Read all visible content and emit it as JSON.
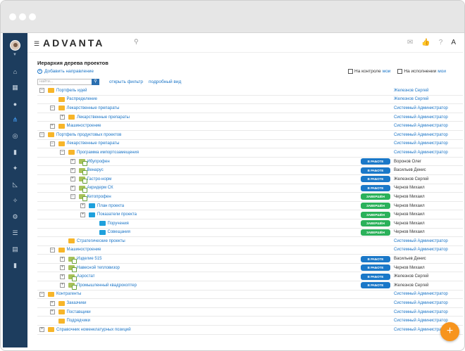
{
  "app": {
    "logo": "ADVANTA"
  },
  "page": {
    "title": "Иерархия дерева проектов",
    "add_direction": "Добавить направление",
    "search_placeholder": "найти...",
    "open_filter": "открыть фильтр",
    "detail_view": "подробный вид",
    "on_control": "На контроле",
    "on_execution": "На исполнении",
    "mine": "мои"
  },
  "tree": [
    {
      "indent": 0,
      "toggle": "–",
      "icon": "folder-yellow",
      "name": "Портфель идей",
      "badge": "",
      "badge_color": "",
      "owner": "Железнов Сергей",
      "owner_link": true
    },
    {
      "indent": 1,
      "toggle": "",
      "icon": "folder-yellow",
      "name": "Распределение",
      "badge": "",
      "badge_color": "",
      "owner": "Железнов Сергей",
      "owner_link": true
    },
    {
      "indent": 1,
      "toggle": "–",
      "icon": "folder-yellow",
      "name": "Лекарственные препараты",
      "badge": "",
      "badge_color": "",
      "owner": "Системный Администратор",
      "owner_link": true
    },
    {
      "indent": 2,
      "toggle": "+",
      "icon": "folder-yellow",
      "name": "Лекарственные препараты",
      "badge": "",
      "badge_color": "",
      "owner": "Системный Администратор",
      "owner_link": true
    },
    {
      "indent": 1,
      "toggle": "+",
      "icon": "folder-yellow",
      "name": "Машиностроение",
      "badge": "",
      "badge_color": "",
      "owner": "Системный Администратор",
      "owner_link": true
    },
    {
      "indent": 0,
      "toggle": "–",
      "icon": "folder-yellow",
      "name": "Портфель продуктовых проектов",
      "badge": "",
      "badge_color": "",
      "owner": "Системный Администратор",
      "owner_link": true
    },
    {
      "indent": 1,
      "toggle": "–",
      "icon": "folder-yellow",
      "name": "Лекарственные препараты",
      "badge": "",
      "badge_color": "",
      "owner": "Системный Администратор",
      "owner_link": true
    },
    {
      "indent": 2,
      "toggle": "–",
      "icon": "folder-yellow",
      "name": "Программа импортозамещения",
      "badge": "",
      "badge_color": "",
      "owner": "Системный Администратор",
      "owner_link": true
    },
    {
      "indent": 3,
      "toggle": "+",
      "icon": "project",
      "name": "Ибупрофен",
      "badge": "В РАБОТЕ",
      "badge_color": "blue",
      "owner": "Воронов Олег",
      "owner_link": false
    },
    {
      "indent": 3,
      "toggle": "+",
      "icon": "project",
      "name": "Венарус",
      "badge": "В РАБОТЕ",
      "badge_color": "blue",
      "owner": "Васильев Денис",
      "owner_link": false
    },
    {
      "indent": 3,
      "toggle": "+",
      "icon": "project",
      "name": "Гастро-норм",
      "badge": "В РАБОТЕ",
      "badge_color": "blue",
      "owner": "Железнов Сергей",
      "owner_link": false
    },
    {
      "indent": 3,
      "toggle": "+",
      "icon": "project",
      "name": "Акридерм СК",
      "badge": "В РАБОТЕ",
      "badge_color": "blue",
      "owner": "Чернов Михаил",
      "owner_link": false
    },
    {
      "indent": 3,
      "toggle": "–",
      "icon": "project",
      "name": "Кетопрофен",
      "badge": "ЗАВЕРШЁН",
      "badge_color": "green",
      "owner": "Чернов Михаил",
      "owner_link": false
    },
    {
      "indent": 4,
      "toggle": "+",
      "icon": "folder-blue",
      "name": "План проекта",
      "badge": "ЗАВЕРШЁН",
      "badge_color": "green",
      "owner": "Чернов Михаил",
      "owner_link": false
    },
    {
      "indent": 4,
      "toggle": "+",
      "icon": "folder-blue",
      "name": "Показатели проекта",
      "badge": "ЗАВЕРШЁН",
      "badge_color": "green",
      "owner": "Чернов Михаил",
      "owner_link": false
    },
    {
      "indent": 5,
      "toggle": "",
      "icon": "folder-blue",
      "name": "Поручения",
      "badge": "ЗАВЕРШЁН",
      "badge_color": "green",
      "owner": "Чернов Михаил",
      "owner_link": false
    },
    {
      "indent": 5,
      "toggle": "",
      "icon": "folder-blue",
      "name": "Совещания",
      "badge": "ЗАВЕРШЁН",
      "badge_color": "green",
      "owner": "Чернов Михаил",
      "owner_link": false
    },
    {
      "indent": 2,
      "toggle": "",
      "icon": "folder-yellow",
      "name": "Стратегические проекты",
      "badge": "",
      "badge_color": "",
      "owner": "Системный Администратор",
      "owner_link": true
    },
    {
      "indent": 1,
      "toggle": "–",
      "icon": "folder-yellow",
      "name": "Машиностроение",
      "badge": "",
      "badge_color": "",
      "owner": "Системный Администратор",
      "owner_link": true
    },
    {
      "indent": 2,
      "toggle": "+",
      "icon": "project",
      "name": "Изделие 515",
      "badge": "В РАБОТЕ",
      "badge_color": "blue",
      "owner": "Васильев Денис",
      "owner_link": false
    },
    {
      "indent": 2,
      "toggle": "+",
      "icon": "project",
      "name": "Навесной тепловизор",
      "badge": "В РАБОТЕ",
      "badge_color": "blue",
      "owner": "Чернов Михаил",
      "owner_link": false
    },
    {
      "indent": 2,
      "toggle": "+",
      "icon": "project",
      "name": "Аэростат",
      "badge": "В РАБОТЕ",
      "badge_color": "blue",
      "owner": "Железнов Сергей",
      "owner_link": false
    },
    {
      "indent": 2,
      "toggle": "+",
      "icon": "project",
      "name": "Промышленный квадрокоптер",
      "badge": "В РАБОТЕ",
      "badge_color": "blue",
      "owner": "Железнов Сергей",
      "owner_link": false
    },
    {
      "indent": 0,
      "toggle": "–",
      "icon": "folder-yellow",
      "name": "Контрагенты",
      "badge": "",
      "badge_color": "",
      "owner": "Системный Администратор",
      "owner_link": true
    },
    {
      "indent": 1,
      "toggle": "+",
      "icon": "folder-yellow",
      "name": "Заказчики",
      "badge": "",
      "badge_color": "",
      "owner": "Системный Администратор",
      "owner_link": true
    },
    {
      "indent": 1,
      "toggle": "+",
      "icon": "folder-yellow",
      "name": "Поставщики",
      "badge": "",
      "badge_color": "",
      "owner": "Системный Администратор",
      "owner_link": true
    },
    {
      "indent": 1,
      "toggle": "",
      "icon": "folder-yellow",
      "name": "Подрядчики",
      "badge": "",
      "badge_color": "",
      "owner": "Системный Администратор",
      "owner_link": true
    },
    {
      "indent": 0,
      "toggle": "+",
      "icon": "folder-yellow",
      "name": "Справочник номенклатурных позиций",
      "badge": "",
      "badge_color": "",
      "owner": "Системный Администратор",
      "owner_link": true
    }
  ]
}
